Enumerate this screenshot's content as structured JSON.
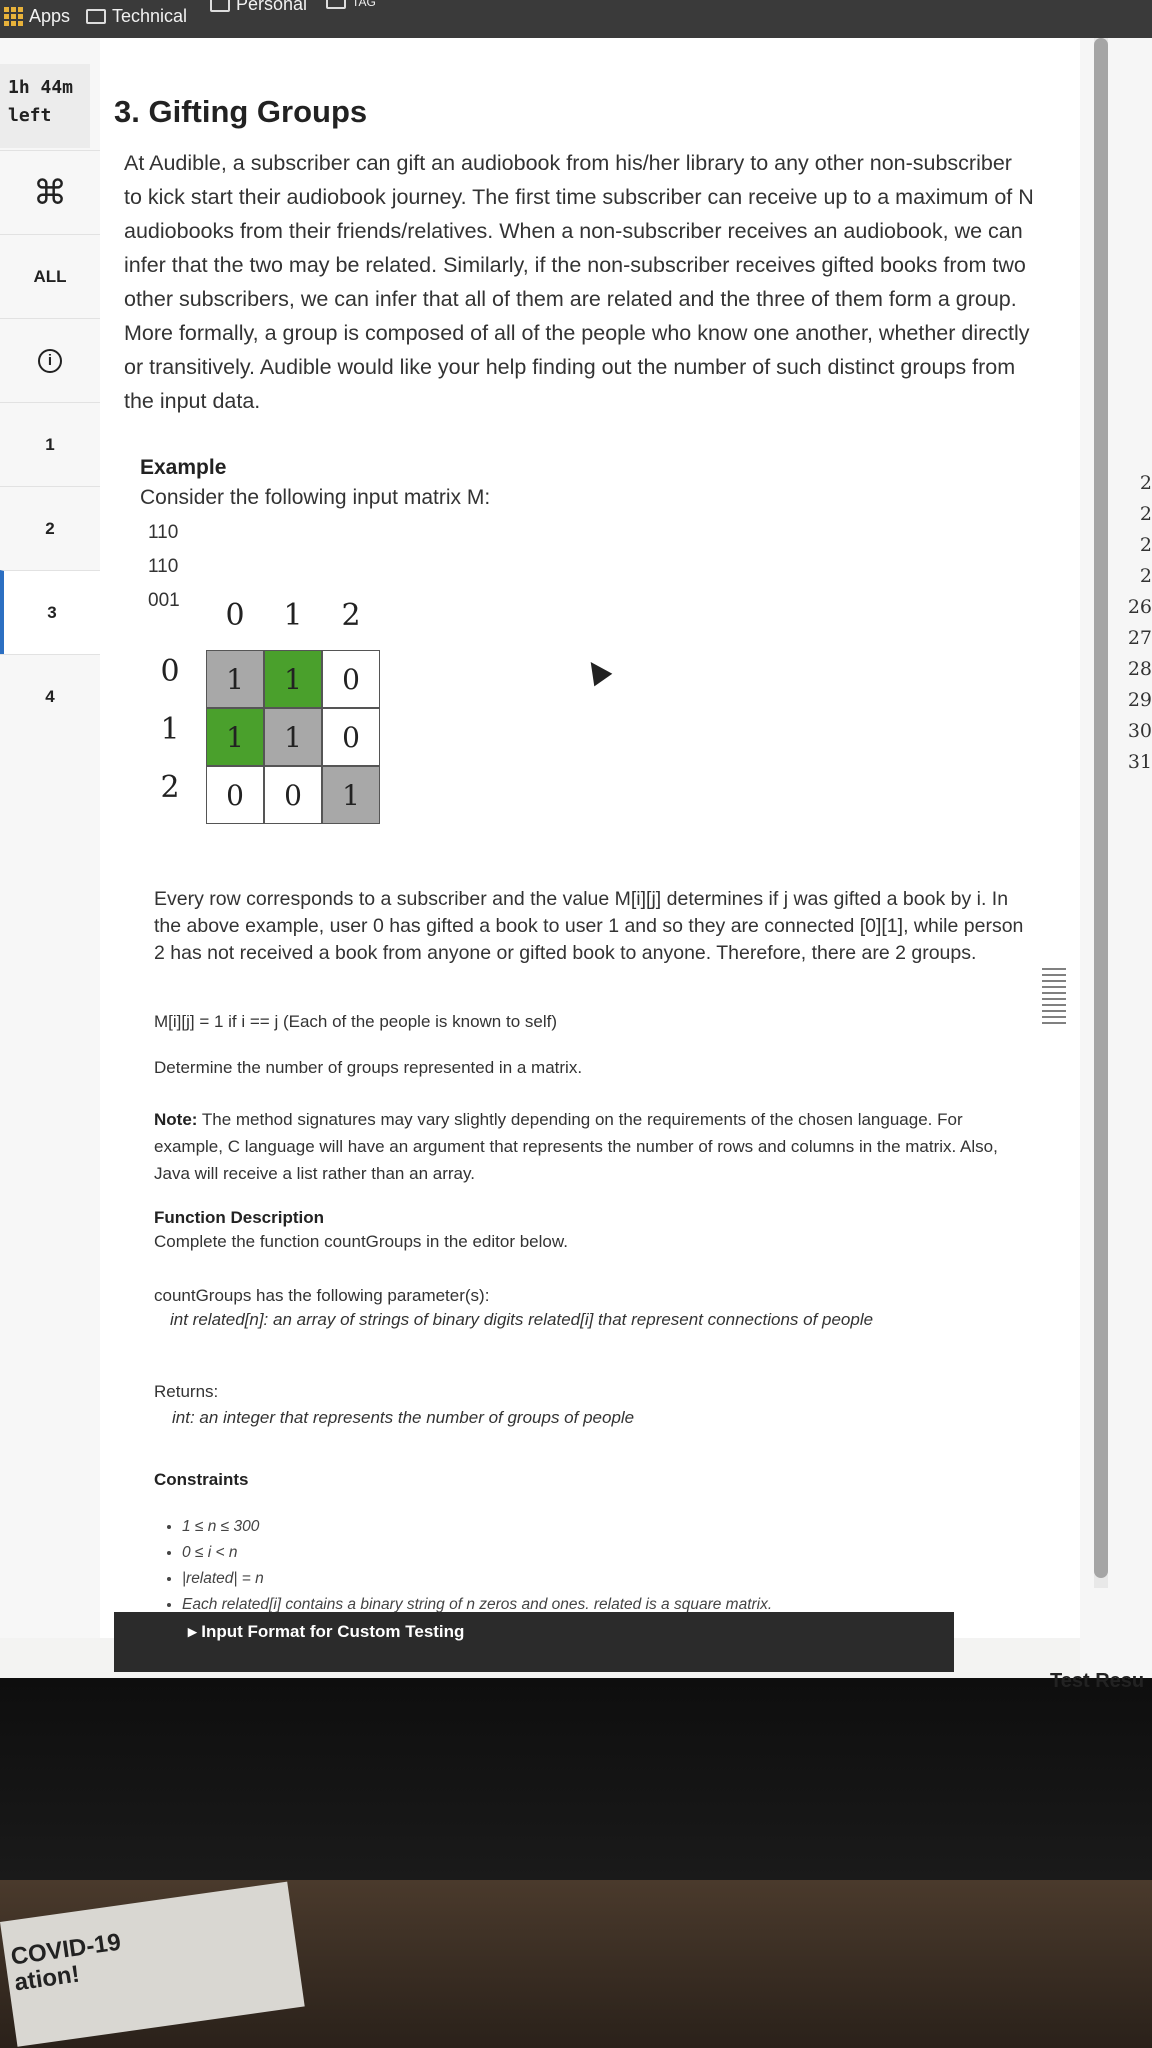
{
  "bookmarks": {
    "apps": "Apps",
    "technical": "Technical",
    "personal": "Personal",
    "tag": "TAG"
  },
  "sidebar": {
    "timer_line1": "1h 44m",
    "timer_line2": "left",
    "all_label": "ALL",
    "items": [
      "1",
      "2",
      "3",
      "4"
    ],
    "active_item": "3"
  },
  "problem": {
    "title": "3. Gifting Groups",
    "intro": "At Audible, a subscriber can gift an audiobook from his/her library to any other non-subscriber to kick start their audiobook journey. The first time subscriber can receive up to a maximum of N audiobooks from their friends/relatives. When a non-subscriber receives an audiobook, we can infer that the two may be related. Similarly, if the non-subscriber receives gifted books from two other subscribers, we can infer that all of them are related and the three of them form a group. More formally, a group is composed of all of the people who know one another, whether directly or transitively. Audible would like your help finding out the number of such distinct groups from the input data.",
    "example_label": "Example",
    "example_text": "Consider the following input matrix M:",
    "matrix_rows": [
      "110",
      "110",
      "001"
    ],
    "matrix": {
      "col_labels": [
        "0",
        "1",
        "2"
      ],
      "row_labels": [
        "0",
        "1",
        "2"
      ],
      "cells": [
        [
          "1",
          "1",
          "0"
        ],
        [
          "1",
          "1",
          "0"
        ],
        [
          "0",
          "0",
          "1"
        ]
      ],
      "green_color": "#4aa02c",
      "gray_color": "#a8a8a8"
    },
    "explanation": "Every row corresponds to a subscriber and the value M[i][j] determines if j was gifted a book by i. In the above example, user 0 has gifted a book to user 1 and so they are connected [0][1], while person 2 has not received a book from anyone or gifted book to anyone. Therefore, there are 2 groups.",
    "self_rule": "M[i][j] = 1 if i == j (Each of the people is known to self)",
    "task": "Determine the number of groups represented in a matrix.",
    "note_label": "Note:",
    "note": "The method signatures may vary slightly depending on the requirements of the chosen language. For example, C language will have an argument that represents the number of rows and columns in the matrix. Also, Java will receive a list rather than an array.",
    "func_desc_label": "Function Description",
    "func_desc": "Complete the function countGroups in the editor below.",
    "params_intro": "countGroups has the following parameter(s):",
    "param": "int related[n]:  an array of strings of binary digits related[i] that represent connections of people",
    "returns_label": "Returns:",
    "returns": "int: an integer that represents the number of groups of people",
    "constraints_label": "Constraints",
    "constraints": [
      "1 ≤ n ≤ 300",
      "0 ≤ i < n",
      "|related| = n",
      "Each related[i] contains a binary string of n zeros and ones. related is a square matrix."
    ],
    "input_format": "▸ Input Format for Custom Testing"
  },
  "editor": {
    "line_numbers": [
      "2",
      "2",
      "2",
      "2",
      "26",
      "27",
      "28",
      "29",
      "30",
      "31"
    ],
    "test_result": "Test Resu"
  },
  "sticker": {
    "line1": "COVID-19",
    "line2": "ation!"
  }
}
